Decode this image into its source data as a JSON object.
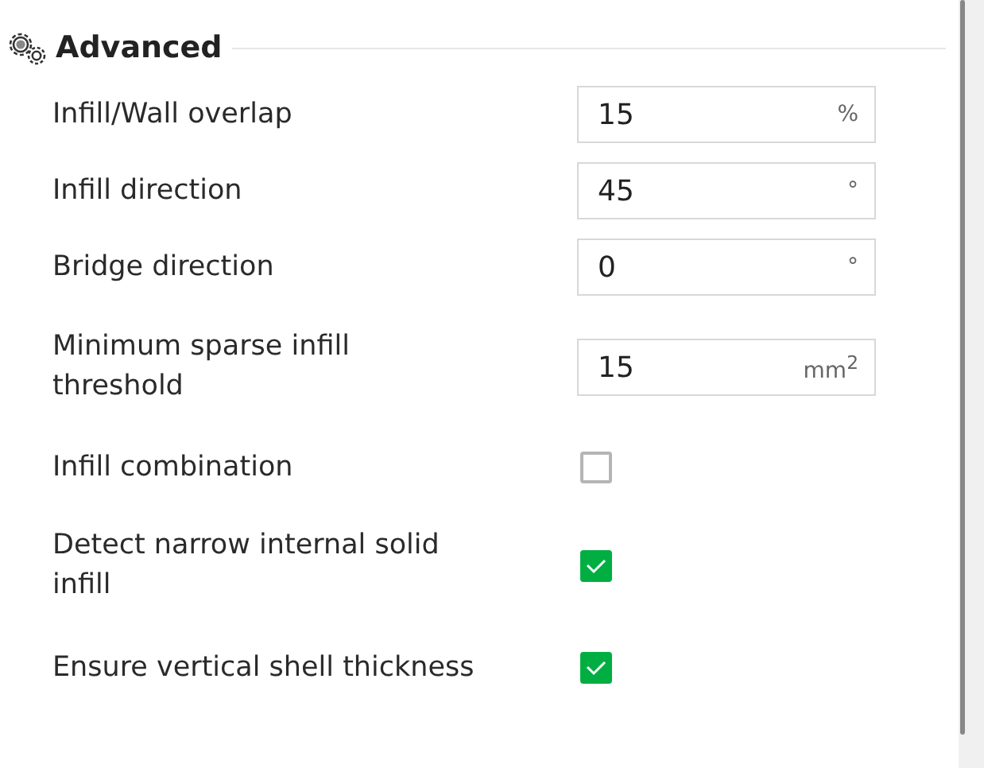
{
  "section": {
    "title": "Advanced"
  },
  "settings": [
    {
      "kind": "number",
      "label": "Infill/Wall overlap",
      "value": "15",
      "unit": "%"
    },
    {
      "kind": "number",
      "label": "Infill direction",
      "value": "45",
      "unit": "°"
    },
    {
      "kind": "number",
      "label": "Bridge direction",
      "value": "0",
      "unit": "°"
    },
    {
      "kind": "number",
      "label": "Minimum sparse infill threshold",
      "value": "15",
      "unit": "mm$^{2}$"
    },
    {
      "kind": "checkbox",
      "label": "Infill combination",
      "checked": false
    },
    {
      "kind": "checkbox",
      "label": "Detect narrow internal solid infill",
      "checked": true
    },
    {
      "kind": "checkbox",
      "label": "Ensure vertical shell thickness",
      "checked": true
    }
  ]
}
